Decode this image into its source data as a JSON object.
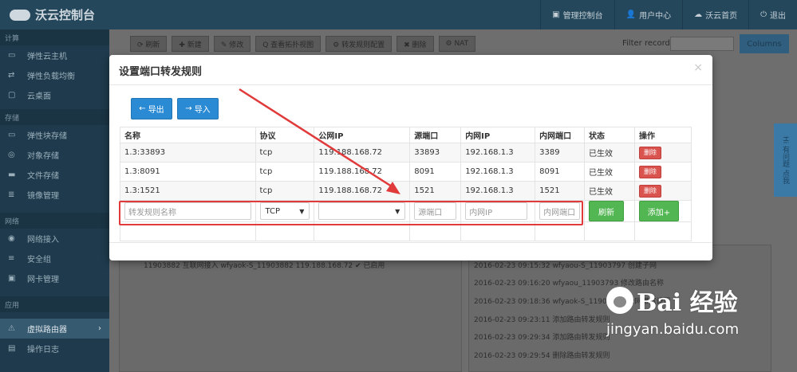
{
  "topbar": {
    "brand": "沃云控制台",
    "nav": [
      {
        "icon": "monitor-icon",
        "glyph": "▣",
        "label": "管理控制台"
      },
      {
        "icon": "user-icon",
        "glyph": "👤",
        "label": "用户中心"
      },
      {
        "icon": "cloud-icon",
        "glyph": "☁",
        "label": "沃云首页"
      },
      {
        "icon": "power-icon",
        "glyph": "⏻",
        "label": "退出"
      }
    ]
  },
  "sidebar": {
    "sections": [
      {
        "title": "计算",
        "items": [
          {
            "icon": "server-icon",
            "glyph": "▭",
            "label": "弹性云主机"
          },
          {
            "icon": "balance-icon",
            "glyph": "⇄",
            "label": "弹性负载均衡"
          },
          {
            "icon": "desktop-icon",
            "glyph": "▢",
            "label": "云桌面"
          }
        ]
      },
      {
        "title": "存储",
        "items": [
          {
            "icon": "disk-icon",
            "glyph": "▭",
            "label": "弹性块存储"
          },
          {
            "icon": "object-icon",
            "glyph": "◎",
            "label": "对象存储"
          },
          {
            "icon": "folder-icon",
            "glyph": "▬",
            "label": "文件存储"
          },
          {
            "icon": "image-icon",
            "glyph": "≣",
            "label": "镜像管理"
          }
        ]
      },
      {
        "title": "网络",
        "items": [
          {
            "icon": "globe-icon",
            "glyph": "◉",
            "label": "网络接入"
          },
          {
            "icon": "shield-icon",
            "glyph": "≡",
            "label": "安全组"
          },
          {
            "icon": "nic-icon",
            "glyph": "▣",
            "label": "网卡管理"
          }
        ]
      },
      {
        "title": "应用",
        "items": [
          {
            "icon": "app-icon",
            "glyph": "⚠",
            "label": "虚拟路由器",
            "active": true
          },
          {
            "icon": "log-icon",
            "glyph": "▤",
            "label": "操作日志"
          }
        ]
      }
    ]
  },
  "toolbar": {
    "buttons": [
      "⟳ 刷新",
      "✚ 新建",
      "✎ 修改",
      "Q 查看拓扑视图",
      "⚙ 转发规则配置",
      "✖ 删除",
      "⚙ NAT"
    ],
    "filter_label": "Filter records:",
    "columns_label": "Columns"
  },
  "background": {
    "left_row": "11903882   互联网接入   wfyaok-S_11903882   119.188.168.72   ✔ 已启用",
    "right_rows": [
      "2016-02-23 09:15:32 wfyaou-S_11903797 创建子网",
      "2016-02-23 09:16:20 wfyaou_11903793 修改路由名称",
      "2016-02-23 09:18:36 wfyaok-S_11903882 公网带宽设置",
      "2016-02-23 09:23:11 添加路由转发规则",
      "2016-02-23 09:29:34 添加路由转发规则",
      "2016-02-23 09:29:54 删除路由转发规则"
    ],
    "side_tab": "Hi 有问题 点我"
  },
  "modal": {
    "title": "设置端口转发规则",
    "close": "×",
    "export_label": "导出",
    "import_label": "导入",
    "columns": [
      "名称",
      "协议",
      "公网IP",
      "源端口",
      "内网IP",
      "内网端口",
      "状态",
      "操作"
    ],
    "rows": [
      {
        "name": "1.3:33893",
        "protocol": "tcp",
        "public_ip": "119.188.168.72",
        "src_port": "33893",
        "private_ip": "192.168.1.3",
        "private_port": "3389",
        "status": "已生效",
        "action": "删除"
      },
      {
        "name": "1.3:8091",
        "protocol": "tcp",
        "public_ip": "119.188.168.72",
        "src_port": "8091",
        "private_ip": "192.168.1.3",
        "private_port": "8091",
        "status": "已生效",
        "action": "删除"
      },
      {
        "name": "1.3:1521",
        "protocol": "tcp",
        "public_ip": "119.188.168.72",
        "src_port": "1521",
        "private_ip": "192.168.1.3",
        "private_port": "1521",
        "status": "已生效",
        "action": "删除"
      }
    ],
    "form": {
      "name_placeholder": "转发规则名称",
      "protocol_value": "TCP",
      "public_ip_value": "",
      "src_port_placeholder": "源端口",
      "private_ip_placeholder": "内网IP",
      "private_port_placeholder": "内网端口",
      "refresh_label": "刷新",
      "add_label": "添加+"
    }
  },
  "watermark": {
    "logo": "Bai  经验",
    "url": "jingyan.baidu.com"
  },
  "colors": {
    "accent_blue": "#2a8ad4",
    "danger": "#d9534f",
    "success": "#52b652",
    "highlight": "#e03a3a"
  }
}
